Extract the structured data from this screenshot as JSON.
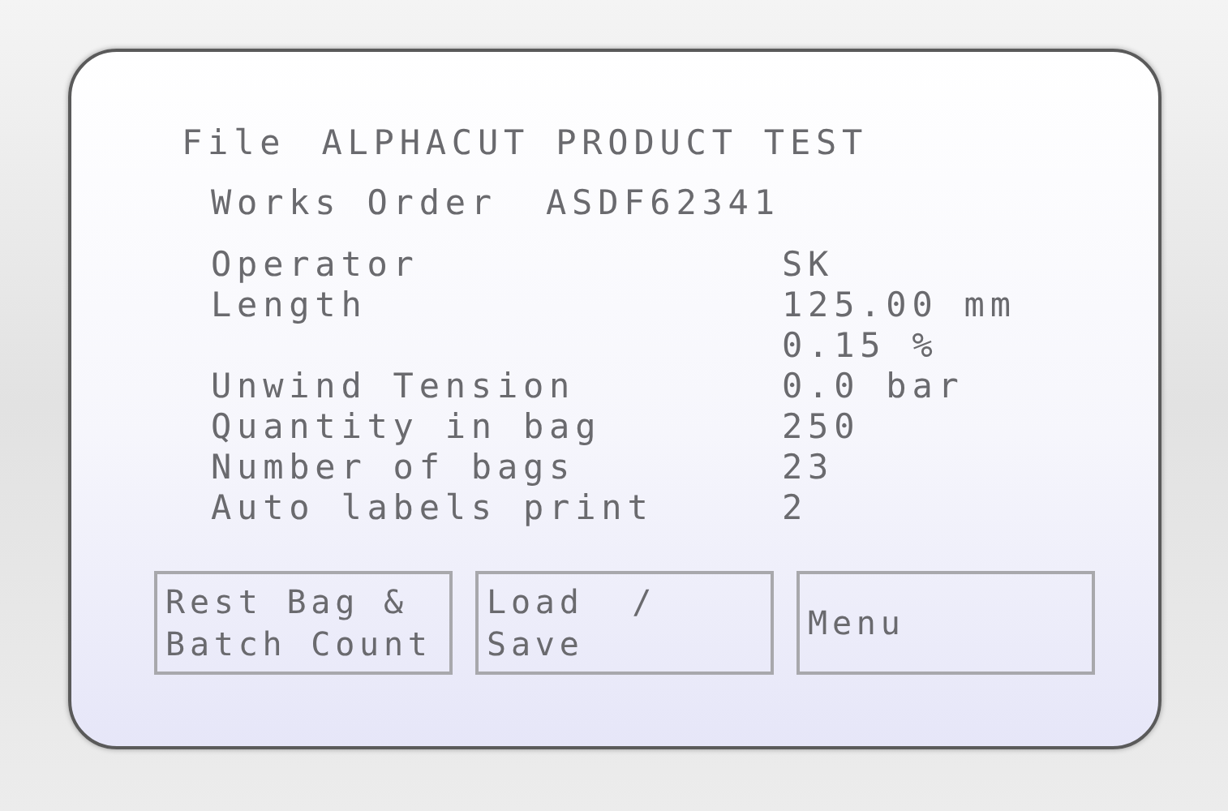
{
  "header": {
    "menu": "File",
    "title": "ALPHACUT PRODUCT TEST"
  },
  "works_order": {
    "label": "Works Order",
    "value": "ASDF62341"
  },
  "fields": [
    {
      "label": "Operator",
      "value": "SK"
    },
    {
      "label": "Length",
      "value": "125.00 mm"
    },
    {
      "value": "0.15 %"
    },
    {
      "label": "Unwind Tension",
      "value": "0.0 bar"
    },
    {
      "label": "Quantity in bag",
      "value": "250"
    },
    {
      "label": "Number of bags",
      "value": "23"
    },
    {
      "label": "Auto labels print",
      "value": "2"
    }
  ],
  "buttons": [
    {
      "lines": [
        "Rest Bag &",
        "Batch Count"
      ]
    },
    {
      "lines": [
        "Load  /",
        "Save"
      ]
    },
    {
      "lines": [
        "Menu"
      ]
    }
  ]
}
